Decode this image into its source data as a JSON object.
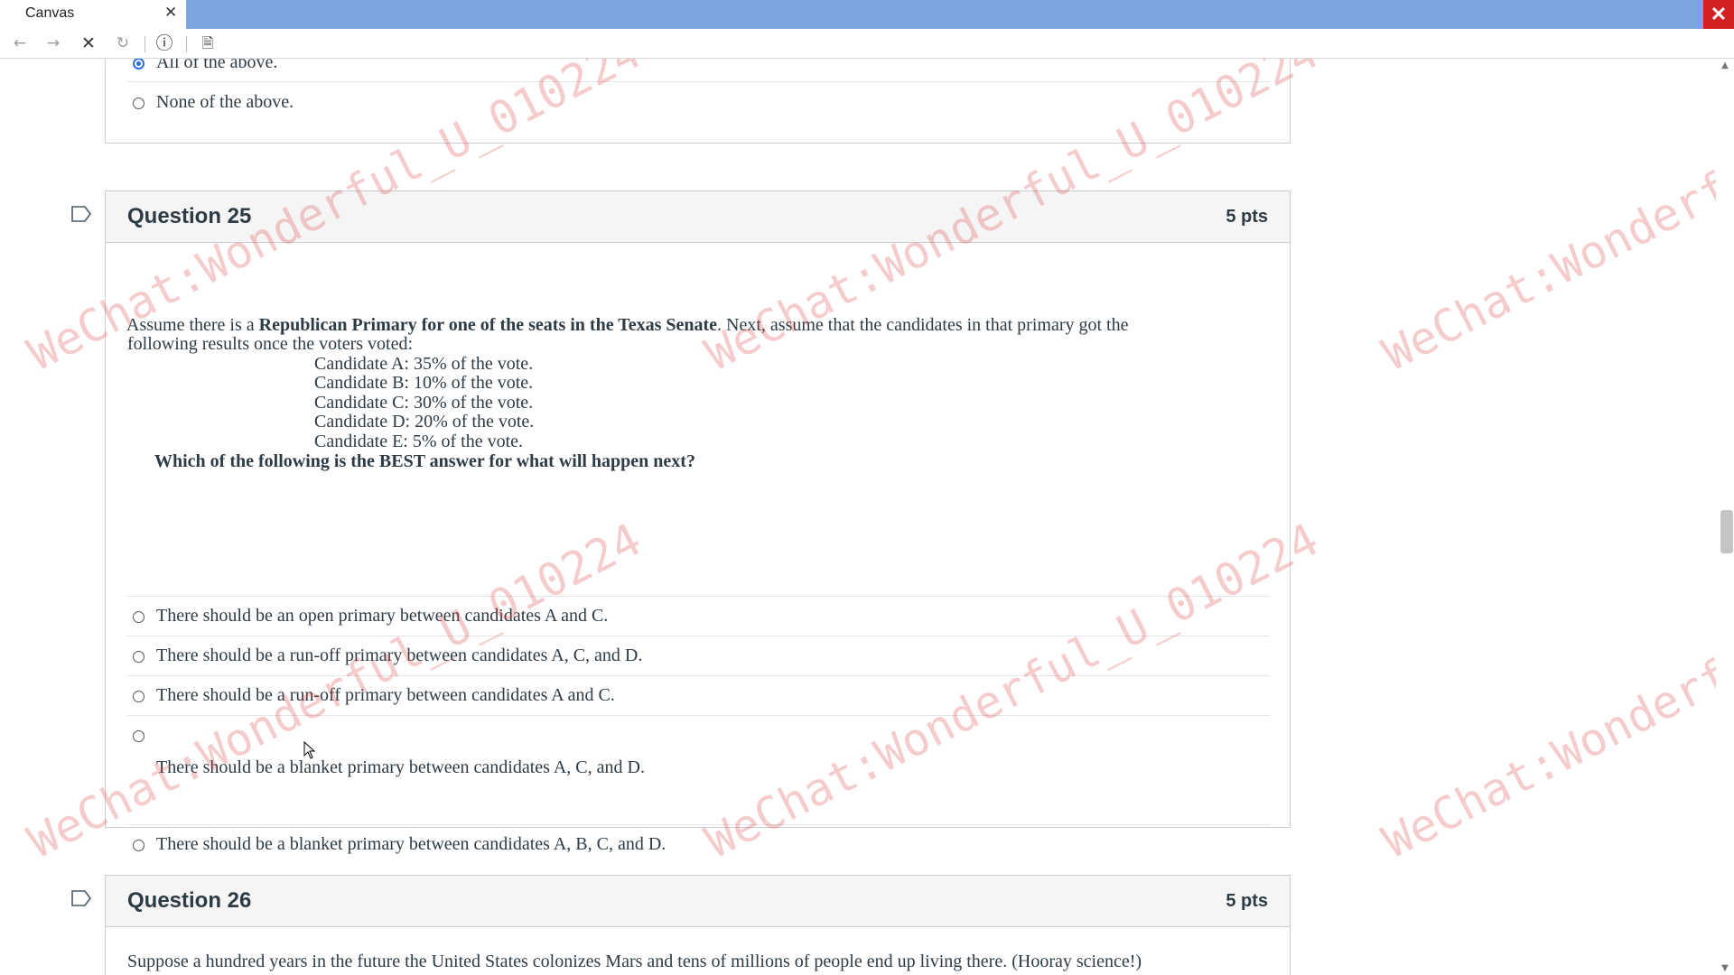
{
  "browser": {
    "tab_title": "Canvas",
    "tab_close": "✕",
    "window_close": "✕",
    "buttons": {
      "back": "←",
      "forward": "→",
      "stop": "✕",
      "reload": "↻",
      "info": "ⓘ",
      "page": "🗎"
    }
  },
  "prev_question": {
    "answers": [
      {
        "text": "All of the above.",
        "selected": true
      },
      {
        "text": "None of the above.",
        "selected": false
      }
    ]
  },
  "question25": {
    "title": "Question 25",
    "points": "5 pts",
    "intro_1": "Assume there is a ",
    "intro_bold": "Republican Primary for one of the seats in the Texas Senate",
    "intro_2": ".  Next, assume that the candidates in that primary got the",
    "intro_line2": "following results once the voters voted:",
    "results": [
      "Candidate A:  35% of the vote.",
      "Candidate B:  10% of the vote.",
      "Candidate C:  30% of the vote.",
      "Candidate D:  20% of the vote.",
      "Candidate E:  5% of the vote."
    ],
    "prompt": "Which of the following is the BEST answer for what will happen next?",
    "answers": [
      {
        "text": "There should be an open primary between candidates A and C.",
        "selected": false
      },
      {
        "text": "There should be a run-off primary between candidates A, C, and D.",
        "selected": false
      },
      {
        "text": "There should be a run-off primary between candidates A and C.",
        "selected": false
      },
      {
        "text": "There should be a blanket primary between candidates A, C, and D.",
        "selected": false
      },
      {
        "text": "There should be a blanket primary between candidates A, B, C, and D.",
        "selected": false
      }
    ]
  },
  "question26": {
    "title": "Question 26",
    "points": "5 pts",
    "body_start": "Suppose a hundred years in the future the United States colonizes Mars and tens of millions of people end up living there. (Hooray science!)"
  },
  "watermark": "WeChat:Wonderful_U_010224",
  "colors": {
    "tab_bar": "#7aa5e0",
    "radio_selected": "#2a6fdb",
    "watermark": "#dc4646",
    "header_bg": "#f5f5f5"
  }
}
